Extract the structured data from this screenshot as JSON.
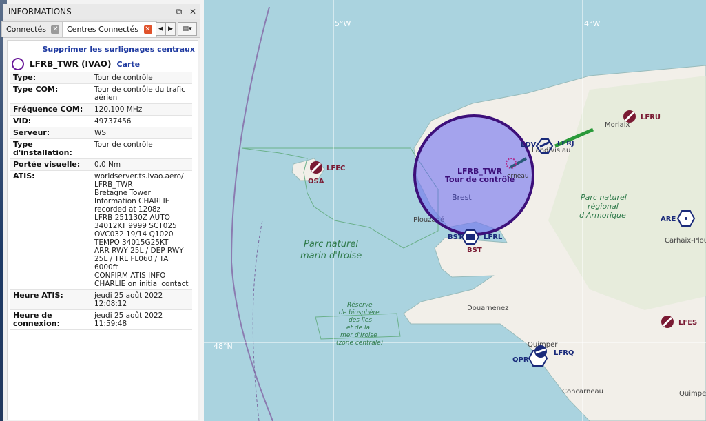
{
  "panel": {
    "title": "INFORMATIONS",
    "float_icon": "⧉",
    "close_icon": "✕",
    "tabs": [
      {
        "label": "Connectés"
      },
      {
        "label": "Centres Connectés"
      }
    ]
  },
  "content": {
    "remove_highlights": "Supprimer les surlignages centraux",
    "station_name": "LFRB_TWR (IVAO)",
    "map_link": "Carte",
    "rows": [
      {
        "key": "Type:",
        "value": "Tour de contrôle"
      },
      {
        "key": "Type COM:",
        "value": "Tour de contrôle du trafic\naérien"
      },
      {
        "key": "Fréquence COM:",
        "value": "120,100 MHz"
      },
      {
        "key": "VID:",
        "value": "49737456"
      },
      {
        "key": "Serveur:",
        "value": "WS"
      },
      {
        "key": "Type d'installation:",
        "value": "Tour de contrôle"
      },
      {
        "key": "Portée visuelle:",
        "value": "0,0 Nm"
      },
      {
        "key": "ATIS:",
        "value": "worldserver.ts.ivao.aero/\nLFRB_TWR\nBretagne Tower\nInformation CHARLIE\nrecorded at 1208z\nLFRB 251130Z AUTO\n34012KT 9999 SCT025\nOVC032 19/14 Q1020\nTEMPO 34015G25KT\nARR RWY 25L / DEP RWY\n25L / TRL FL060 / TA 6000ft\nCONFIRM ATIS INFO\nCHARLIE on initial contact"
      },
      {
        "key": "Heure ATIS:",
        "value": "jeudi 25 août 2022 12:08:12"
      },
      {
        "key": "Heure de connexion:",
        "value": "jeudi 25 août 2022 11:59:48"
      }
    ]
  },
  "map": {
    "grid_labels": {
      "lon_w": "5°W",
      "lon_e": "4°W",
      "lat": "48°N"
    },
    "station_label": "LFRB_TWR",
    "station_sub": "Tour de contrôle",
    "airports": [
      {
        "code": "LFEC",
        "alt": "OSA"
      },
      {
        "code": "LFRJ",
        "alt": "LDV"
      },
      {
        "code": "LFRU"
      },
      {
        "code": "LFES"
      },
      {
        "code": "LFRQ",
        "alt": "QPR"
      },
      {
        "code": "LFRL",
        "alt": "BST"
      }
    ],
    "navaids": [
      "ARE",
      "BST"
    ],
    "places": [
      "Brest",
      "Plouzané",
      "Landerneau",
      "Landivisiau",
      "Morlaix",
      "Carhaix-Plouguer",
      "Douarnenez",
      "Quimper",
      "Concarneau",
      "Quimperlé"
    ],
    "park_armorique": "Parc naturel\nrégional\nd'Armorique",
    "park_iroise": "Parc naturel\nmarin d'Iroise",
    "biosphere": "Réserve\nde biosphère\ndes îles\net de la\nmer d'Iroise\n(zone centrale)",
    "colors": {
      "sea": "#aad3df",
      "land": "#f2efe9",
      "station": "#3d0f7a",
      "tower": "#7a1a33",
      "airport_blue": "#1a2a7a"
    }
  }
}
